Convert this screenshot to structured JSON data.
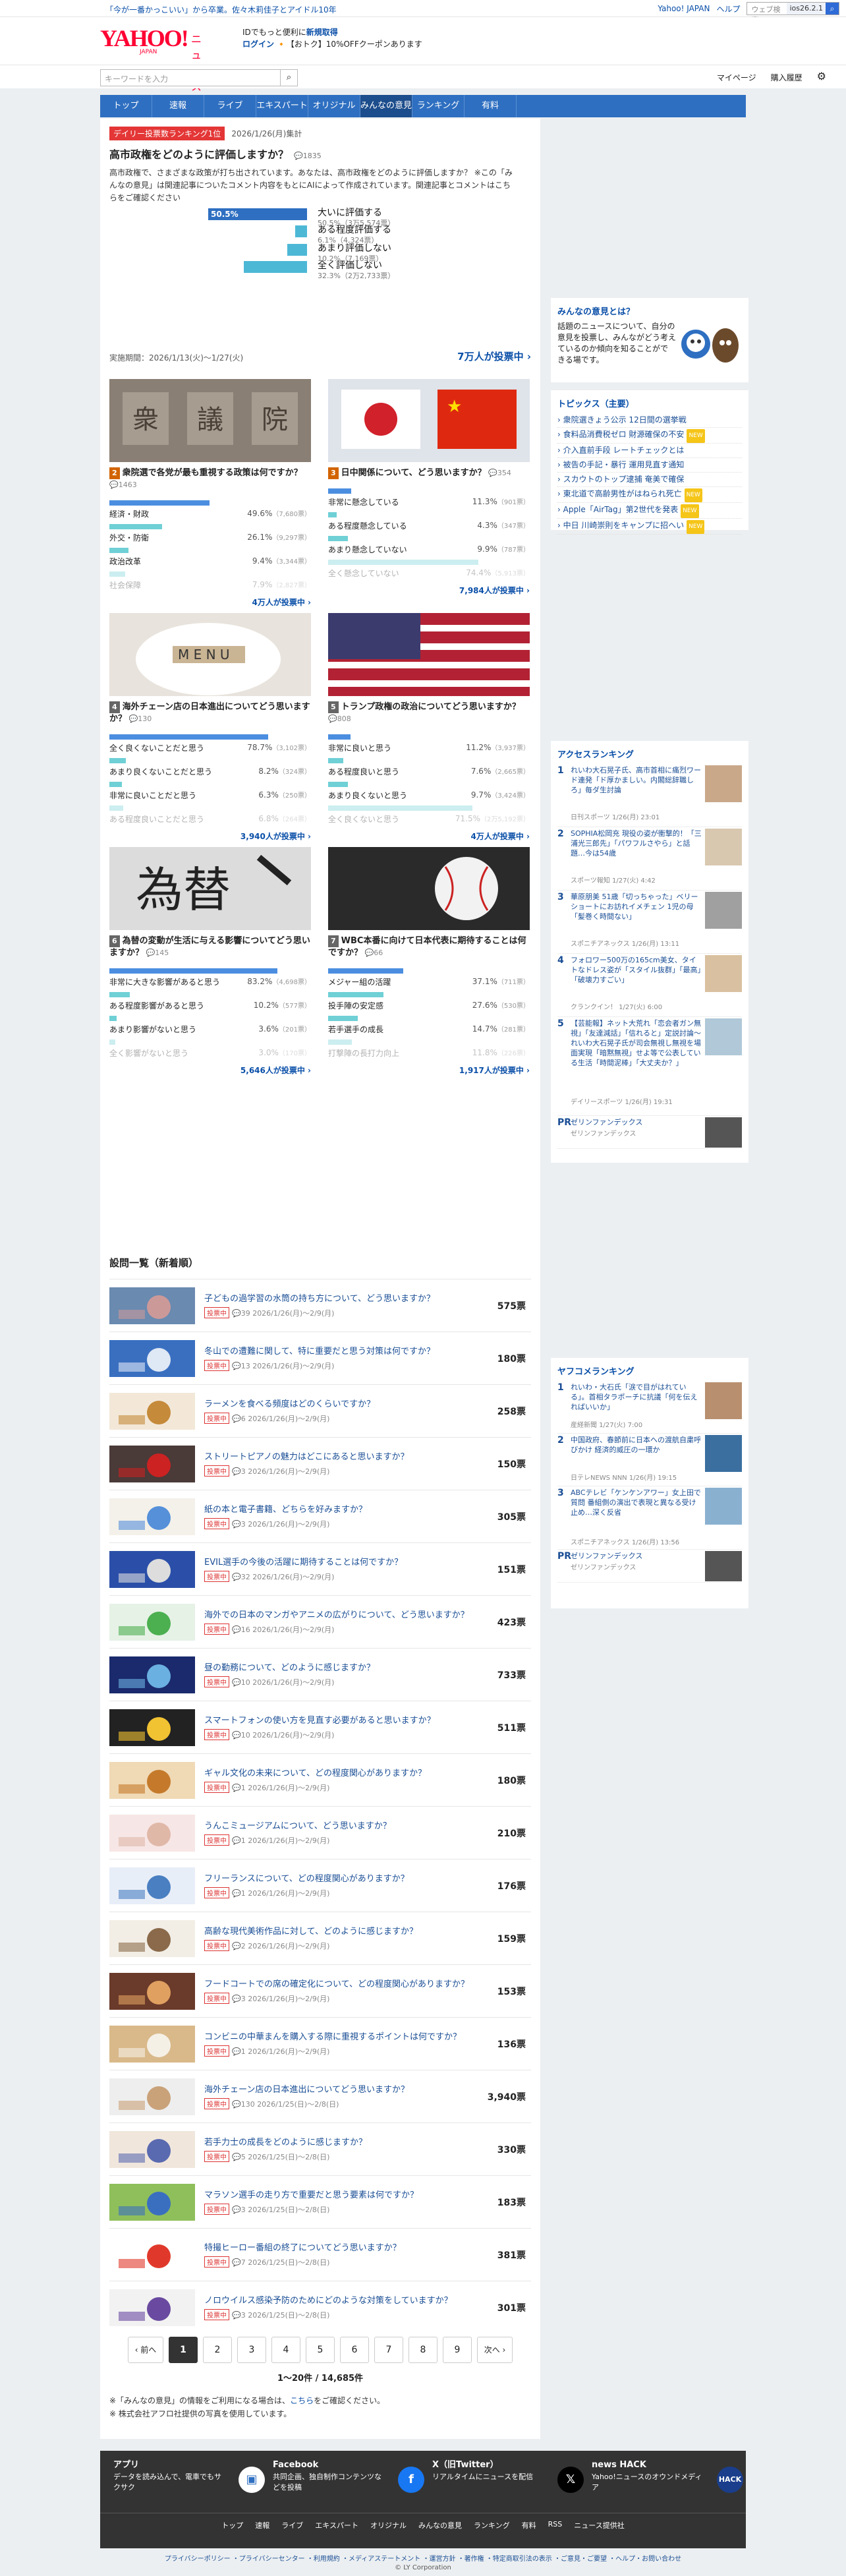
{
  "topbar": {
    "promo": "「今が一番かっこいい」から卒業。佐々木莉佳子とアイドル10年",
    "yahoo_japan": "Yahoo! JAPAN",
    "help": "ヘルプ",
    "weather_placeholder": "ウェブ検索",
    "ios": "ios26.2.1"
  },
  "header": {
    "logo": "YAHOO!",
    "logo_sub": "JAPAN",
    "service": "ニュース",
    "line1": "IDでもっと便利に",
    "line1_link": "新規取得",
    "login": "ログイン",
    "coupon": "【おトク】10%OFFクーポンあります"
  },
  "search": {
    "placeholder": "キーワードを入力",
    "mypage": "マイページ",
    "history": "購入履歴"
  },
  "nav": [
    "トップ",
    "速報",
    "ライブ",
    "エキスパート",
    "オリジナル",
    "みんなの意見",
    "ランキング",
    "有料"
  ],
  "hero": {
    "badge": "デイリー投票数ランキング1位",
    "date": "2026/1/26(月)集計",
    "question": "高市政権をどのように評価しますか？",
    "comments": "1835",
    "desc": "高市政権で、さまざまな政策が打ち出されています。あなたは、高市政権をどのように評価しますか？ ※この「みんなの意見」は関連記事についたコメント内容をもとにAIによって作成されています。関連記事とコメントはこちらをご確認ください",
    "options": [
      {
        "pct": "50.5%",
        "p": 50.5,
        "label": "大いに評価する",
        "val": "50.5%（3万5,574票）"
      },
      {
        "pct": "",
        "p": 6.1,
        "label": "ある程度評価する",
        "val": "6.1%（4,324票）"
      },
      {
        "pct": "",
        "p": 10.2,
        "label": "あまり評価しない",
        "val": "10.2%（7,169票）"
      },
      {
        "pct": "32.3%",
        "p": 32.3,
        "label": "全く評価しない",
        "val": "32.3%（2万2,733票）"
      }
    ],
    "period": "実施期間：2026/1/13(火)〜1/27(火)",
    "votes": "7万人が投票中 ›"
  },
  "cards": [
    {
      "no": "2",
      "color": "#d26400",
      "title": "衆院選で各党が最も重視する政策は何ですか？",
      "meta": "1463",
      "opts": [
        {
          "n": "経済・財政",
          "v": "49.6%",
          "c": "（7,680票）",
          "p": 49.6
        },
        {
          "n": "外交・防衛",
          "v": "26.1%",
          "c": "（9,297票）",
          "p": 26.1
        },
        {
          "n": "政治改革",
          "v": "9.4%",
          "c": "（3,344票）",
          "p": 9.4
        },
        {
          "n": "社会保障",
          "v": "7.9%",
          "c": "（2,827票）",
          "p": 7.9
        }
      ],
      "more": "4万人が投票中 ›"
    },
    {
      "no": "3",
      "color": "#d26400",
      "title": "日中関係について、どう思いますか？",
      "meta": "354",
      "opts": [
        {
          "n": "非常に懸念している",
          "v": "11.3%",
          "c": "（901票）",
          "p": 11.3
        },
        {
          "n": "ある程度懸念している",
          "v": "4.3%",
          "c": "（347票）",
          "p": 4.3
        },
        {
          "n": "あまり懸念していない",
          "v": "9.9%",
          "c": "（787票）",
          "p": 9.9
        },
        {
          "n": "全く懸念していない",
          "v": "74.4%",
          "c": "（5,913票）",
          "p": 74.4
        }
      ],
      "more": "7,984人が投票中 ›"
    },
    {
      "no": "4",
      "color": "#666",
      "title": "海外チェーン店の日本進出についてどう思いますか？",
      "meta": "130",
      "opts": [
        {
          "n": "全く良くないことだと思う",
          "v": "78.7%",
          "c": "（3,102票）",
          "p": 78.7
        },
        {
          "n": "あまり良くないことだと思う",
          "v": "8.2%",
          "c": "（324票）",
          "p": 8.2
        },
        {
          "n": "非常に良いことだと思う",
          "v": "6.3%",
          "c": "（250票）",
          "p": 6.3
        },
        {
          "n": "ある程度良いことだと思う",
          "v": "6.8%",
          "c": "（264票）",
          "p": 6.8
        }
      ],
      "more": "3,940人が投票中 ›"
    },
    {
      "no": "5",
      "color": "#666",
      "title": "トランプ政権の政治についてどう思いますか？",
      "meta": "808",
      "opts": [
        {
          "n": "非常に良いと思う",
          "v": "11.2%",
          "c": "（3,937票）",
          "p": 11.2
        },
        {
          "n": "ある程度良いと思う",
          "v": "7.6%",
          "c": "（2,665票）",
          "p": 7.6
        },
        {
          "n": "あまり良くないと思う",
          "v": "9.7%",
          "c": "（3,424票）",
          "p": 9.7
        },
        {
          "n": "全く良くないと思う",
          "v": "71.5%",
          "c": "（2万5,192票）",
          "p": 71.5
        }
      ],
      "more": "4万人が投票中 ›"
    },
    {
      "no": "6",
      "color": "#666",
      "title": "為替の変動が生活に与える影響についてどう思いますか？",
      "meta": "145",
      "opts": [
        {
          "n": "非常に大きな影響があると思う",
          "v": "83.2%",
          "c": "（4,698票）",
          "p": 83.2
        },
        {
          "n": "ある程度影響があると思う",
          "v": "10.2%",
          "c": "（577票）",
          "p": 10.2
        },
        {
          "n": "あまり影響がないと思う",
          "v": "3.6%",
          "c": "（201票）",
          "p": 3.6
        },
        {
          "n": "全く影響がないと思う",
          "v": "3.0%",
          "c": "（170票）",
          "p": 3.0
        }
      ],
      "more": "5,646人が投票中 ›"
    },
    {
      "no": "7",
      "color": "#666",
      "title": "WBC本番に向けて日本代表に期待することは何ですか？",
      "meta": "66",
      "opts": [
        {
          "n": "メジャー組の活躍",
          "v": "37.1%",
          "c": "（711票）",
          "p": 37.1
        },
        {
          "n": "投手陣の安定感",
          "v": "27.6%",
          "c": "（530票）",
          "p": 27.6
        },
        {
          "n": "若手選手の成長",
          "v": "14.7%",
          "c": "（281票）",
          "p": 14.7
        },
        {
          "n": "打撃陣の長打力向上",
          "v": "11.8%",
          "c": "（226票）",
          "p": 11.8
        }
      ],
      "more": "1,917人が投票中 ›"
    }
  ],
  "list_title": "設問一覧（新着順）",
  "list": [
    {
      "q": "子どもの過学習の水筒の持ち方について、どう思いますか？",
      "m": "39  2026/1/26(月)〜2/9(月)",
      "c": "575票"
    },
    {
      "q": "冬山での遭難に関して、特に重要だと思う対策は何ですか？",
      "m": "13  2026/1/26(月)〜2/9(月)",
      "c": "180票"
    },
    {
      "q": "ラーメンを食べる頻度はどのくらいですか？",
      "m": "6  2026/1/26(月)〜2/9(月)",
      "c": "258票"
    },
    {
      "q": "ストリートピアノの魅力はどこにあると思いますか？",
      "m": "3  2026/1/26(月)〜2/9(月)",
      "c": "150票"
    },
    {
      "q": "紙の本と電子書籍、どちらを好みますか？",
      "m": "3  2026/1/26(月)〜2/9(月)",
      "c": "305票"
    },
    {
      "q": "EVIL選手の今後の活躍に期待することは何ですか？",
      "m": "32  2026/1/26(月)〜2/9(月)",
      "c": "151票"
    },
    {
      "q": "海外での日本のマンガやアニメの広がりについて、どう思いますか？",
      "m": "16  2026/1/26(月)〜2/9(月)",
      "c": "423票"
    },
    {
      "q": "昼の勤務について、どのように感じますか？",
      "m": "10  2026/1/26(月)〜2/9(月)",
      "c": "733票"
    },
    {
      "q": "スマートフォンの使い方を見直す必要があると思いますか？",
      "m": "10  2026/1/26(月)〜2/9(月)",
      "c": "511票"
    },
    {
      "q": "ギャル文化の未来について、どの程度関心がありますか？",
      "m": "1  2026/1/26(月)〜2/9(月)",
      "c": "180票"
    },
    {
      "q": "うんこミュージアムについて、どう思いますか？",
      "m": "1  2026/1/26(月)〜2/9(月)",
      "c": "210票"
    },
    {
      "q": "フリーランスについて、どの程度関心がありますか？",
      "m": "1  2026/1/26(月)〜2/9(月)",
      "c": "176票"
    },
    {
      "q": "高齢な現代美術作品に対して、どのように感じますか？",
      "m": "2  2026/1/26(月)〜2/9(月)",
      "c": "159票"
    },
    {
      "q": "フードコートでの席の確定化について、どの程度関心がありますか？",
      "m": "3  2026/1/26(月)〜2/9(月)",
      "c": "153票"
    },
    {
      "q": "コンビニの中華まんを購入する際に重視するポイントは何ですか？",
      "m": "1  2026/1/26(月)〜2/9(月)",
      "c": "136票"
    },
    {
      "q": "海外チェーン店の日本進出についてどう思いますか？",
      "m": "130  2026/1/25(日)〜2/8(日)",
      "c": "3,940票"
    },
    {
      "q": "若手力士の成長をどのように感じますか？",
      "m": "5  2026/1/25(日)〜2/8(日)",
      "c": "330票"
    },
    {
      "q": "マラソン選手の走り方で重要だと思う要素は何ですか？",
      "m": "3  2026/1/25(日)〜2/8(日)",
      "c": "183票"
    },
    {
      "q": "特撮ヒーロー番組の終了についてどう思いますか？",
      "m": "7  2026/1/25(日)〜2/8(日)",
      "c": "381票"
    },
    {
      "q": "ノロウイルス感染予防のためにどのような対策をしていますか？",
      "m": "3  2026/1/25(日)〜2/8(日)",
      "c": "301票"
    }
  ],
  "pager": {
    "prev": "‹ 前へ",
    "next": "次へ ›",
    "pages": [
      "1",
      "2",
      "3",
      "4",
      "5",
      "6",
      "7",
      "8",
      "9"
    ],
    "count": "1〜20件 / 14,685件"
  },
  "notes": {
    "n1a": "※「みんなの意見」の情報をご利用になる場合は、",
    "n1b": "こちら",
    "n1c": "をご確認ください。",
    "n2": "※ 株式会社アフロ社提供の写真を使用しています。"
  },
  "side": {
    "about_title": "みんなの意見とは？",
    "about_text": "話題のニュースについて、自分の意見を投票し、みんながどう考えているのか傾向を知ることができる場です。",
    "topics_title": "トピックス（主要）",
    "topics": [
      {
        "t": "衆院選きょう公示 12日間の選挙戦",
        "n": ""
      },
      {
        "t": "食料品消費税ゼロ 財源確保の不安",
        "n": "NEW"
      },
      {
        "t": "介入直前手段 レートチェックとは",
        "n": ""
      },
      {
        "t": "被告の手記・暴行 運用見直す通知",
        "n": ""
      },
      {
        "t": "スカウトのトップ逮捕 奄美で確保",
        "n": ""
      },
      {
        "t": "東北道で高齢男性がはねられ死亡",
        "n": "NEW"
      },
      {
        "t": "Apple「AirTag」第2世代を発表",
        "n": "NEW"
      },
      {
        "t": "中日 川崎崇則をキャンプに招へい",
        "n": "NEW"
      }
    ],
    "access_title": "アクセスランキング",
    "access": [
      {
        "n": "1",
        "t": "れいわ大石晃子氏、高市首相に痛烈ワード連発「ド厚かましい。内閣総辞職しろ」毎ダ生討論",
        "s": "日刊スポーツ 1/26(月) 23:01"
      },
      {
        "n": "2",
        "t": "SOPHIA松岡充 現役の姿が衝撃的！「三浦光三郎先」「パワフルさやら」と話題…今は54歳",
        "s": "スポーツ報知 1/27(火) 4:42"
      },
      {
        "n": "3",
        "t": "華原朋美 51歳「切っちゃった」ベリーショートにお訪れイメチェン 1児の母「髪巻く時間ない」",
        "s": "スポニチアネックス 1/26(月) 13:11"
      },
      {
        "n": "4",
        "t": "フォロワー500万の165cm美女、タイトなドレス姿が「スタイル抜群」「最高」「破壊力すごい」",
        "s": "クランクイン！ 1/27(火) 6:00"
      },
      {
        "n": "5",
        "t": "【芸能報】ネット大荒れ「恋会者ガン無視」「友達減話」「信れると」定説討論〜れいわ大石晃子氏が司会無視し無視を場面実現「暗黙無視」せよ等で公表している生活「時間泥棒」「大丈夫か？」",
        "s": "デイリースポーツ 1/26(月) 19:31"
      }
    ],
    "pr": {
      "label": "PR",
      "t": "ゼリンファンデックス",
      "s": "ゼリンファンデックス"
    },
    "comment_title": "ヤフコメランキング",
    "comment": [
      {
        "n": "1",
        "t": "れいわ・大石氏「涙で目がはれている」。首相タラポーチに抗議「何を伝えればいいか」",
        "s": "産経新聞 1/27(火) 7:00"
      },
      {
        "n": "2",
        "t": "中国政府、春節前に日本への渡航自粛呼びかけ 経済的威圧の一環か",
        "s": "日テレNEWS NNN 1/26(月) 19:15"
      },
      {
        "n": "3",
        "t": "ABCテレビ「ケンケンアワー」女上田で質問 番組側の演出で表現と異なる受け止め…深く反省",
        "s": "スポニチアネックス 1/26(月) 13:56"
      }
    ],
    "pr2": {
      "label": "PR",
      "t": "ゼリンファンデックス",
      "s": "ゼリンファンデックス"
    }
  },
  "footer": {
    "app_t": "アプリ",
    "app_d": "データを読み込んで、電車でもサクサク",
    "fb_t": "Facebook",
    "fb_d": "共同企画、独自制作コンテンツなどを投稿",
    "x_t": "X（旧Twitter）",
    "x_d": "リアルタイムにニュースを配信",
    "hack_t": "news HACK",
    "hack_d": "Yahoo!ニュースのオウンドメディア",
    "nav": [
      "トップ",
      "速報",
      "ライブ",
      "エキスパート",
      "オリジナル",
      "みんなの意見",
      "ランキング",
      "有料",
      "RSS",
      "ニュース提供社"
    ],
    "links": "プライバシーポリシー ・プライバシーセンター ・利用規約 ・メディアステートメント ・運営方針 ・著作権 ・特定商取引法の表示 ・ご意見・ご要望 ・ヘルプ・お問い合わせ",
    "copy": "© LY Corporation"
  },
  "colors": {
    "accent": "#2e6fc1",
    "red": "#e43636",
    "link": "#0a4fa8"
  }
}
